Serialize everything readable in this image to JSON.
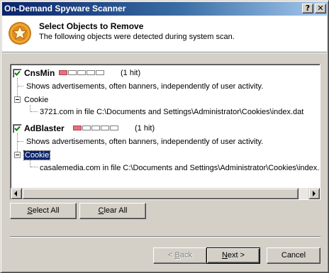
{
  "window": {
    "title": "On-Demand Spyware Scanner",
    "help_glyph": "?",
    "close_glyph": "✕"
  },
  "header": {
    "title": "Select Objects to Remove",
    "subtitle": "The following objects were detected during system scan.",
    "icon": "star-badge-icon"
  },
  "tree": {
    "items": [
      {
        "name": "CnsMin",
        "checked": true,
        "meter_filled": 1,
        "meter_total": 5,
        "hits": "(1 hit)",
        "description": "Shows advertisements, often banners, independently of user activity.",
        "group": "Cookie",
        "entry": "3721.com in file C:\\Documents and Settings\\Administrator\\Cookies\\index.dat"
      },
      {
        "name": "AdBlaster",
        "checked": true,
        "meter_filled": 1,
        "meter_total": 5,
        "hits": "(1 hit)",
        "description": "Shows advertisements, often banners, independently of user activity.",
        "group": "Cookie",
        "group_selected": true,
        "entry": "casalemedia.com in file C:\\Documents and Settings\\Administrator\\Cookies\\index.dat"
      }
    ]
  },
  "buttons": {
    "select_all": {
      "ul": "S",
      "rest": "elect All"
    },
    "clear_all": {
      "ul": "C",
      "rest": "lear All"
    },
    "back": {
      "pre": "< ",
      "ul": "B",
      "rest": "ack"
    },
    "next": {
      "ul": "N",
      "rest": "ext >"
    },
    "cancel": "Cancel"
  },
  "colors": {
    "titlebar_start": "#0a246a",
    "meter_on": "#e8707a",
    "selection": "#0a246a"
  }
}
